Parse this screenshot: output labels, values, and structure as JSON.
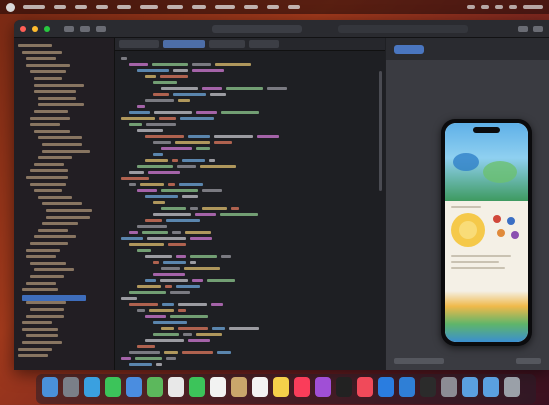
{
  "menubar": {
    "app_name": "",
    "items": [
      "",
      "",
      "",
      "",
      "",
      "",
      "",
      "",
      "",
      "",
      ""
    ]
  },
  "window": {
    "title": "",
    "tabs": [
      "",
      "",
      "",
      ""
    ],
    "active_tab_index": 1,
    "scheme": "",
    "status": ""
  },
  "navigator": {
    "row_count": 48,
    "selected_row_index": 38
  },
  "preview": {
    "tab_label": "",
    "device": "",
    "screen": {
      "title": "",
      "subtitle": ""
    }
  },
  "dock": {
    "icon_count": 23
  },
  "colors": {
    "wallpaper_orange": "#a23a1c",
    "wallpaper_red": "#6b1e20",
    "editor_bg": "#1e1f23",
    "selection_blue": "#3e6dbb",
    "canvas_bg": "#3a3b41",
    "phone_sky": "#5fb0e8",
    "phone_sun": "#f5c94a",
    "phone_grass": "#5fb56a"
  },
  "icons": {
    "menubar": [
      "apple-icon",
      "wifi-icon",
      "battery-icon",
      "search-icon",
      "control-center-icon",
      "clock-icon"
    ],
    "toolbar": [
      "sidebar-toggle-icon",
      "run-icon",
      "stop-icon",
      "library-icon",
      "inspector-toggle-icon"
    ],
    "dock": [
      "finder-icon",
      "launchpad-icon",
      "safari-icon",
      "messages-icon",
      "mail-icon",
      "maps-icon",
      "photos-icon",
      "facetime-icon",
      "calendar-icon",
      "contacts-icon",
      "reminders-icon",
      "notes-icon",
      "music-icon",
      "podcasts-icon",
      "tv-icon",
      "news-icon",
      "app-store-icon",
      "xcode-icon",
      "terminal-icon",
      "settings-icon",
      "folder-icon",
      "downloads-icon",
      "trash-icon"
    ]
  }
}
